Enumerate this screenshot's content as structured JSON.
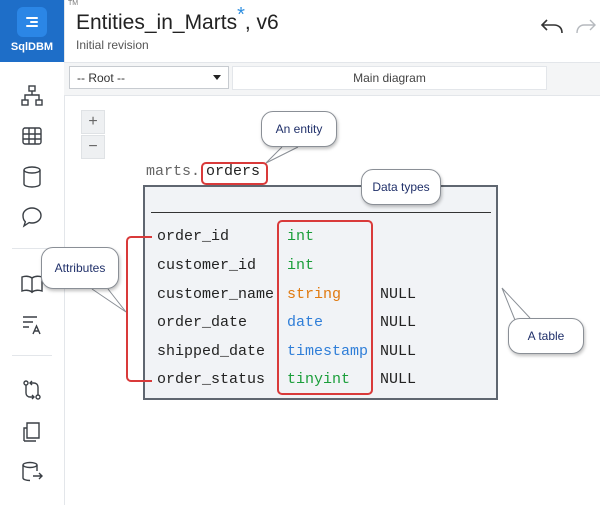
{
  "app": {
    "brand": "SqlDBM",
    "trademark": "TM"
  },
  "header": {
    "title": "Entities_in_Marts",
    "unsaved_marker": "*",
    "version": ", v6",
    "subtitle": "Initial revision"
  },
  "toolbar": {
    "root_select_value": "-- Root --",
    "diagram_tab": "Main diagram"
  },
  "zoom": {
    "in": "+",
    "out": "−"
  },
  "entity": {
    "schema": "marts.",
    "name": "orders",
    "columns": [
      {
        "name": "order_id",
        "type": "int",
        "nullable": ""
      },
      {
        "name": "customer_id",
        "type": "int",
        "nullable": ""
      },
      {
        "name": "customer_name",
        "type": "string",
        "nullable": "NULL"
      },
      {
        "name": "order_date",
        "type": "date",
        "nullable": "NULL"
      },
      {
        "name": "shipped_date",
        "type": "timestamp",
        "nullable": "NULL"
      },
      {
        "name": "order_status",
        "type": "tinyint",
        "nullable": "NULL"
      }
    ]
  },
  "callouts": {
    "entity": "An entity",
    "data_types": "Data types",
    "attributes": "Attributes",
    "table": "A table"
  },
  "sidebar_icons": [
    "hierarchy-icon",
    "table-grid-icon",
    "database-icon",
    "comment-icon",
    "book-icon",
    "text-format-icon",
    "compare-icon",
    "document-icon",
    "database-export-icon"
  ],
  "colors": {
    "brand_blue": "#1e6ec8",
    "highlight_red": "#d93a3a",
    "type_int": "#1a9e3a",
    "type_string": "#e07a10",
    "type_date": "#2f7ed8",
    "type_timestamp": "#2f7ed8",
    "type_tinyint": "#1a9e3a"
  }
}
